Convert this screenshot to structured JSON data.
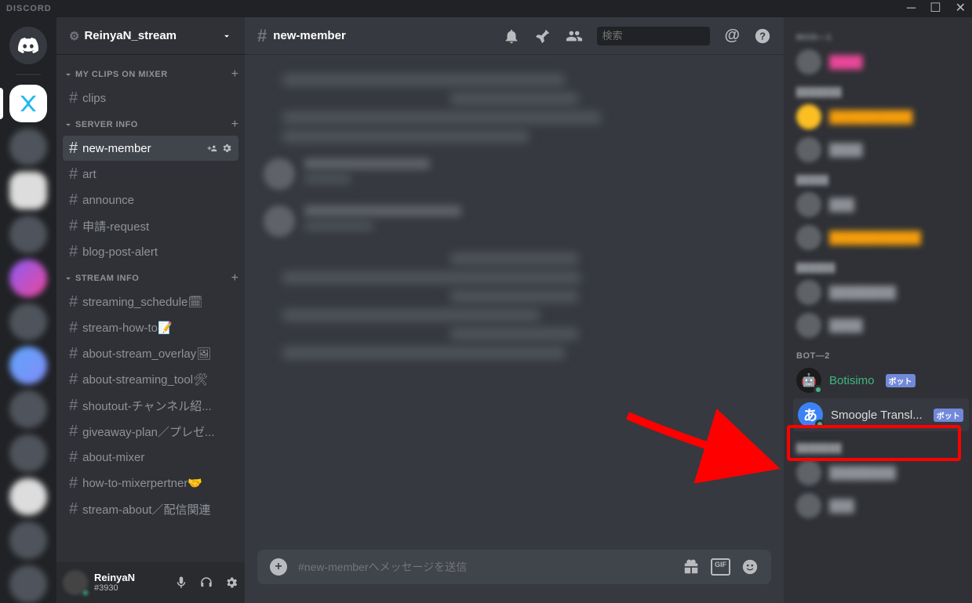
{
  "titlebar": {
    "brand": "DISCORD"
  },
  "server": {
    "name": "ReinyaN_stream"
  },
  "categories": [
    {
      "name": "MY CLIPS ON MIXER",
      "channels": [
        {
          "name": "clips",
          "active": false
        }
      ]
    },
    {
      "name": "SERVER INFO",
      "channels": [
        {
          "name": "new-member",
          "active": true
        },
        {
          "name": "art",
          "active": false
        },
        {
          "name": "announce",
          "active": false
        },
        {
          "name": "申請-request",
          "active": false
        },
        {
          "name": "blog-post-alert",
          "active": false
        }
      ]
    },
    {
      "name": "STREAM INFO",
      "channels": [
        {
          "name": "streaming_schedule🗓",
          "active": false
        },
        {
          "name": "stream-how-to📝",
          "active": false
        },
        {
          "name": "about-stream_overlay🖼",
          "active": false
        },
        {
          "name": "about-streaming_tool🛠",
          "active": false
        },
        {
          "name": "shoutout-チャンネル紹...",
          "active": false
        },
        {
          "name": "giveaway-plan／プレゼ...",
          "active": false
        },
        {
          "name": "about-mixer",
          "active": false
        },
        {
          "name": "how-to-mixerpertner🤝",
          "active": false
        },
        {
          "name": "stream-about／配信関連",
          "active": false
        }
      ]
    }
  ],
  "current_channel": "new-member",
  "chat_input_placeholder": "#new-memberへメッセージを送信",
  "search_placeholder": "検索",
  "user": {
    "name": "ReinyaN",
    "tag": "#3930"
  },
  "members": {
    "groups": [
      {
        "label": "MOD—1",
        "blurred": true
      },
      {
        "label": "",
        "blurred": true
      }
    ],
    "bot_group_label": "BOT—2",
    "bots": [
      {
        "name": "Botisimo",
        "tag": "ボット",
        "class": "botisimo",
        "emoji": "🤖"
      },
      {
        "name": "Smoogle Transl...",
        "tag": "ボット",
        "class": "smoogle",
        "emoji": "あ"
      }
    ]
  }
}
